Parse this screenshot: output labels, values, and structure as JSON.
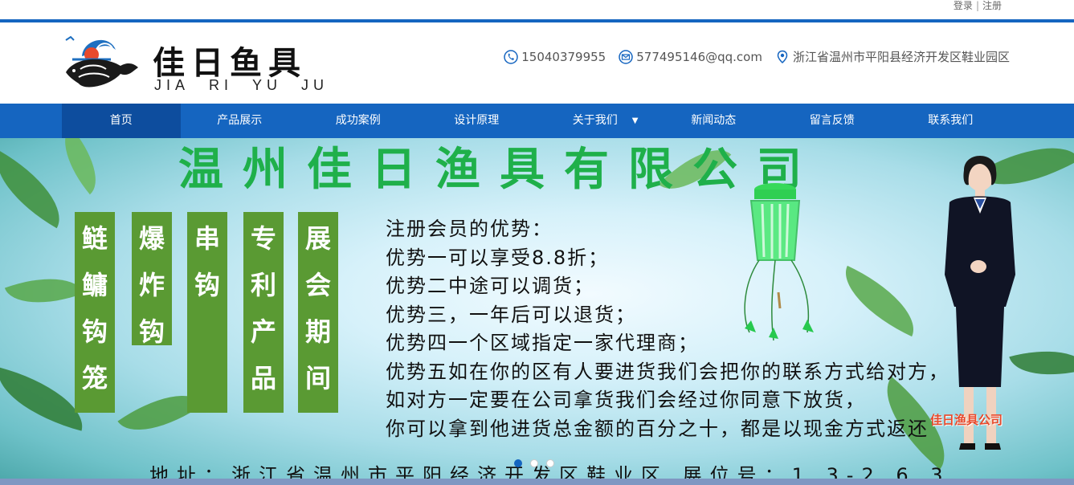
{
  "topbar": {
    "login": "登录",
    "separator": "|",
    "register": "注册"
  },
  "logo": {
    "name_cn": "佳日鱼具",
    "name_en": [
      "JIA",
      "RI",
      "YU",
      "JU"
    ]
  },
  "contact": {
    "phone": "15040379955",
    "email": "577495146@qq.com",
    "address": "浙江省温州市平阳县经济开发区鞋业园区"
  },
  "nav": {
    "items": [
      {
        "label": "首页",
        "active": true
      },
      {
        "label": "产品展示"
      },
      {
        "label": "成功案例"
      },
      {
        "label": "设计原理"
      },
      {
        "label": "关于我们",
        "has_dropdown": true
      },
      {
        "label": "新闻动态"
      },
      {
        "label": "留言反馈"
      },
      {
        "label": "联系我们"
      }
    ]
  },
  "banner": {
    "title": "温州佳日渔具有限公司",
    "blocks": [
      "鲢鳙钩笼",
      "爆炸钩",
      "串钩",
      "专利产品",
      "展会期间"
    ],
    "benefits": [
      "注册会员的优势：",
      "优势一可以享受8.8折；",
      "优势二中途可以调货；",
      "优势三，一年后可以退货；",
      "优势四一个区域指定一家代理商；",
      "优势五如在你的区有人要进货我们会把你的联系方式给对方，",
      "如对方一定要在公司拿货我们会经过你同意下放货，",
      "你可以拿到他进货总金额的百分之十，都是以现金方式返还"
    ],
    "company_tag": "佳日渔具公司",
    "address": "地址：浙江省温州市平阳经济开发区鞋业区 展位号：1 3-2 6 3",
    "slide_count": 3,
    "active_slide": 1
  },
  "colors": {
    "brand_blue": "#1565c0",
    "nav_active": "#0d4d9e",
    "green_title": "#1fb04a",
    "block_green": "#5a9a33"
  }
}
